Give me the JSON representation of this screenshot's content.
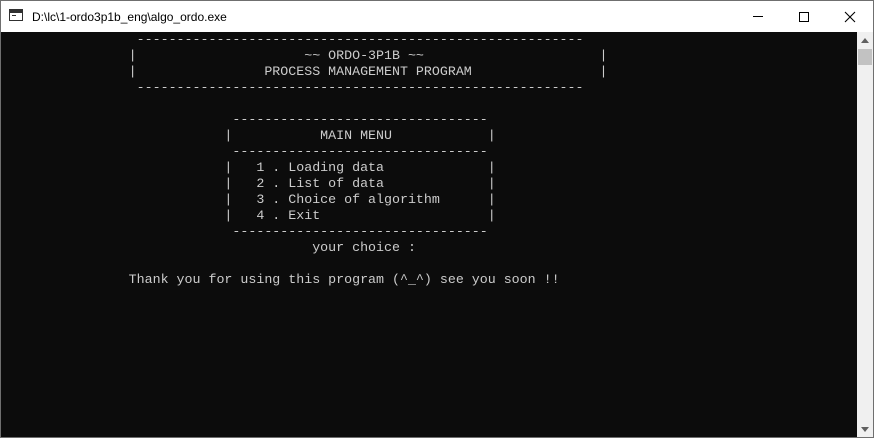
{
  "window": {
    "title": "D:\\lc\\1-ordo3p1b_eng\\algo_ordo.exe",
    "controls": {
      "minimize": "minimize-icon",
      "maximize": "maximize-icon",
      "close": "close-icon"
    }
  },
  "console": {
    "lines": [
      "                 --------------------------------------------------------",
      "                |                     ~~ ORDO-3P1B ~~                      |",
      "                |                PROCESS MANAGEMENT PROGRAM                |",
      "                 --------------------------------------------------------",
      "",
      "                             --------------------------------",
      "                            |           MAIN MENU            |",
      "                             --------------------------------",
      "                            |   1 . Loading data             |",
      "                            |   2 . List of data             |",
      "                            |   3 . Choice of algorithm      |",
      "                            |   4 . Exit                     |",
      "                             --------------------------------",
      "                                       your choice :",
      "",
      "                Thank you for using this program (^_^) see you soon !!"
    ],
    "foreground": "#cccccc",
    "background": "#0c0c0c"
  },
  "scrollbar": {
    "up": "scroll-up-arrow-icon",
    "down": "scroll-down-arrow-icon"
  }
}
